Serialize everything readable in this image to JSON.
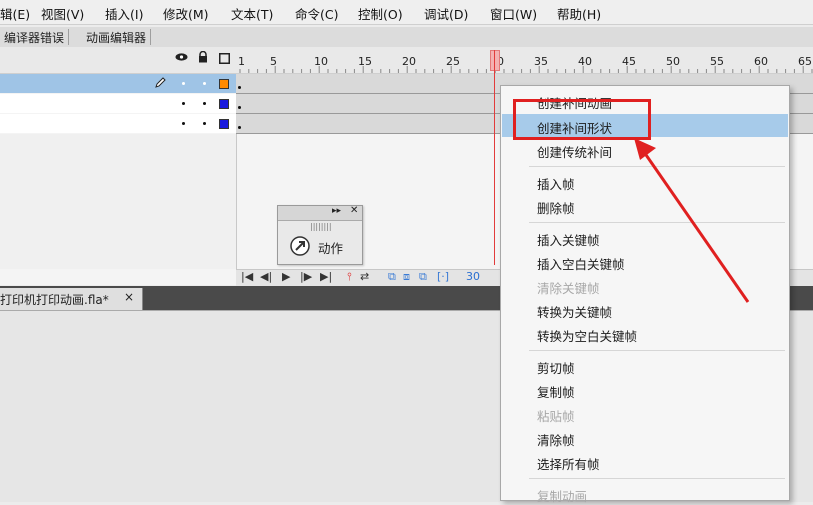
{
  "menubar": {
    "items": [
      "辑(E)",
      "视图(V)",
      "插入(I)",
      "修改(M)",
      "文本(T)",
      "命令(C)",
      "控制(O)",
      "调试(D)",
      "窗口(W)",
      "帮助(H)"
    ]
  },
  "panel_tabs": [
    "编译器错误",
    "动画编辑器"
  ],
  "timeline": {
    "ruler_numbers": [
      "1",
      "5",
      "10",
      "15",
      "20",
      "25",
      "30",
      "35",
      "40",
      "45",
      "50",
      "55",
      "60",
      "65"
    ],
    "current_frame": "30",
    "layer_colors": [
      "#ff8a00",
      "#1a1adc",
      "#1a1adc"
    ]
  },
  "float_panel": {
    "label": "动作"
  },
  "document": {
    "tab_label": "打印机打印动画.fla*",
    "close": "×"
  },
  "context_menu": {
    "items": [
      {
        "label": "创建补间动画",
        "disabled": false
      },
      {
        "label": "创建补间形状",
        "disabled": false,
        "highlighted": true
      },
      {
        "label": "创建传统补间",
        "disabled": false
      },
      {
        "label": "插入帧",
        "disabled": false
      },
      {
        "label": "删除帧",
        "disabled": false
      },
      {
        "label": "插入关键帧",
        "disabled": false
      },
      {
        "label": "插入空白关键帧",
        "disabled": false
      },
      {
        "label": "清除关键帧",
        "disabled": true
      },
      {
        "label": "转换为关键帧",
        "disabled": false
      },
      {
        "label": "转换为空白关键帧",
        "disabled": false
      },
      {
        "label": "剪切帧",
        "disabled": false
      },
      {
        "label": "复制帧",
        "disabled": false
      },
      {
        "label": "粘贴帧",
        "disabled": true
      },
      {
        "label": "清除帧",
        "disabled": false
      },
      {
        "label": "选择所有帧",
        "disabled": false
      },
      {
        "label": "复制动画",
        "disabled": true
      }
    ]
  },
  "colors": {
    "highlight": "#a7cbea",
    "annotation": "#e02020",
    "playhead": "#e23b3b"
  }
}
